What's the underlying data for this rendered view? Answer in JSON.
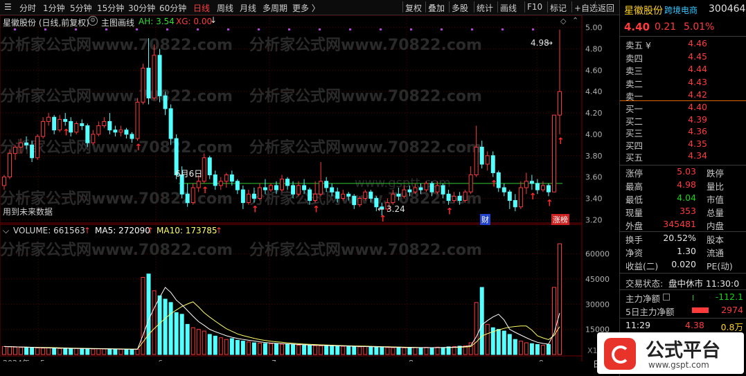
{
  "toolbar": {
    "left_items": [
      "分时",
      "1分钟",
      "5分钟",
      "15分钟",
      "30分钟",
      "60分钟",
      "日线",
      "周线",
      "月线",
      "多周期",
      "更多 〉"
    ],
    "active_item": "日线",
    "right_items": [
      "复权",
      "叠加",
      "多股",
      "统计",
      "画线",
      "F10",
      "标记",
      "+自选",
      "返回"
    ]
  },
  "chart_header": {
    "title": "星徽股份 (日线,前复权)",
    "indicator_name": "主图画线",
    "ah_text": "AH: 3.54",
    "xg_text": "XG: 0.00",
    "ah_color": "#33dd33",
    "xg_color": "#ff3a3a"
  },
  "watermarks": [
    "分析家公式网www.70822.com",
    "www.gsptt.com"
  ],
  "annotations": {
    "high_label": "4.98",
    "low_label": "3.24",
    "date_label": "6月6日",
    "future_data": "用到未来数据",
    "cai_badge": "财",
    "zhang_badge": "涨榜"
  },
  "volume_header": {
    "volume_text": "VOLUME: 661563",
    "ma5_text": "MA5: 272090",
    "ma10_text": "MA10: 173785",
    "x10_text": "X10"
  },
  "axes": {
    "price_ticks": [
      "5.00",
      "4.80",
      "4.60",
      "4.40",
      "4.20",
      "4.00",
      "3.80",
      "3.60",
      "3.40",
      "3.20"
    ],
    "volume_ticks": [
      "60000",
      "45000",
      "30000",
      "15000"
    ],
    "date_ticks": [
      "2024年",
      "5",
      "6",
      "7",
      "8",
      "9"
    ],
    "corner_label": "日"
  },
  "chart_data": {
    "type": "candlestick",
    "title": "星徽股份 (日线,前复权)",
    "ylim": [
      3.15,
      5.05
    ],
    "support_line": 3.54,
    "candles": [
      [
        3.52,
        3.6,
        3.48,
        3.62
      ],
      [
        3.6,
        3.82,
        3.58,
        3.86
      ],
      [
        3.82,
        3.88,
        3.76,
        3.9
      ],
      [
        3.88,
        3.92,
        3.82,
        3.96
      ],
      [
        3.92,
        3.9,
        3.86,
        3.98
      ],
      [
        3.9,
        3.78,
        3.74,
        3.94
      ],
      [
        3.78,
        3.98,
        3.76,
        4.0
      ],
      [
        3.98,
        4.12,
        3.96,
        4.16
      ],
      [
        4.12,
        4.16,
        4.08,
        4.2
      ],
      [
        4.16,
        4.04,
        4.0,
        4.18
      ],
      [
        4.04,
        4.14,
        4.02,
        4.18
      ],
      [
        4.14,
        4.12,
        4.08,
        4.2
      ],
      [
        4.12,
        4.02,
        3.98,
        4.16
      ],
      [
        4.02,
        4.1,
        4.0,
        4.12
      ],
      [
        4.1,
        4.08,
        4.04,
        4.14
      ],
      [
        4.08,
        3.92,
        3.88,
        4.1
      ],
      [
        3.92,
        4.0,
        3.9,
        4.04
      ],
      [
        4.0,
        4.08,
        3.98,
        4.12
      ],
      [
        4.08,
        4.12,
        4.06,
        4.16
      ],
      [
        4.12,
        4.04,
        4.0,
        4.2
      ],
      [
        4.04,
        4.02,
        3.98,
        4.08
      ],
      [
        4.02,
        4.04,
        3.98,
        4.08
      ],
      [
        4.04,
        4.0,
        3.96,
        4.06
      ],
      [
        4.0,
        3.96,
        3.92,
        4.02
      ],
      [
        3.96,
        4.3,
        3.94,
        4.34
      ],
      [
        4.3,
        4.62,
        4.28,
        4.66
      ],
      [
        4.62,
        4.34,
        4.28,
        4.9
      ],
      [
        4.34,
        4.74,
        4.32,
        4.84
      ],
      [
        4.74,
        4.36,
        4.3,
        4.8
      ],
      [
        4.36,
        4.24,
        4.18,
        4.4
      ],
      [
        4.24,
        3.96,
        3.9,
        4.28
      ],
      [
        3.96,
        3.62,
        3.58,
        4.0
      ],
      [
        3.62,
        3.44,
        3.4,
        3.7
      ],
      [
        3.44,
        3.36,
        3.32,
        3.54
      ],
      [
        3.36,
        3.5,
        3.34,
        3.54
      ],
      [
        3.5,
        3.56,
        3.46,
        3.62
      ],
      [
        3.56,
        3.78,
        3.54,
        3.82
      ],
      [
        3.78,
        3.62,
        3.58,
        3.8
      ],
      [
        3.62,
        3.52,
        3.48,
        3.66
      ],
      [
        3.52,
        3.56,
        3.48,
        3.6
      ],
      [
        3.56,
        3.62,
        3.5,
        3.64
      ],
      [
        3.62,
        3.56,
        3.52,
        3.66
      ],
      [
        3.56,
        3.48,
        3.44,
        3.58
      ],
      [
        3.48,
        3.36,
        3.3,
        3.52
      ],
      [
        3.36,
        3.44,
        3.34,
        3.48
      ],
      [
        3.44,
        3.4,
        3.36,
        3.5
      ],
      [
        3.4,
        3.5,
        3.38,
        3.54
      ],
      [
        3.5,
        3.48,
        3.44,
        3.58
      ],
      [
        3.48,
        3.52,
        3.46,
        3.54
      ],
      [
        3.52,
        3.48,
        3.44,
        3.56
      ],
      [
        3.48,
        3.58,
        3.46,
        3.62
      ],
      [
        3.58,
        3.52,
        3.48,
        3.6
      ],
      [
        3.52,
        3.44,
        3.4,
        3.56
      ],
      [
        3.44,
        3.52,
        3.42,
        3.56
      ],
      [
        3.52,
        3.48,
        3.44,
        3.58
      ],
      [
        3.48,
        3.38,
        3.34,
        3.5
      ],
      [
        3.38,
        3.44,
        3.36,
        3.56
      ],
      [
        3.44,
        3.56,
        3.42,
        3.74
      ],
      [
        3.56,
        3.5,
        3.46,
        3.6
      ],
      [
        3.5,
        3.46,
        3.42,
        3.54
      ],
      [
        3.46,
        3.4,
        3.36,
        3.5
      ],
      [
        3.4,
        3.44,
        3.38,
        3.48
      ],
      [
        3.44,
        3.42,
        3.38,
        3.46
      ],
      [
        3.42,
        3.34,
        3.3,
        3.44
      ],
      [
        3.34,
        3.4,
        3.32,
        3.42
      ],
      [
        3.4,
        3.46,
        3.38,
        3.48
      ],
      [
        3.46,
        3.4,
        3.36,
        3.48
      ],
      [
        3.4,
        3.32,
        3.28,
        3.42
      ],
      [
        3.32,
        3.3,
        3.24,
        3.36
      ],
      [
        3.3,
        3.36,
        3.28,
        3.4
      ],
      [
        3.36,
        3.44,
        3.34,
        3.48
      ],
      [
        3.44,
        3.42,
        3.38,
        3.5
      ],
      [
        3.42,
        3.48,
        3.4,
        3.52
      ],
      [
        3.48,
        3.46,
        3.42,
        3.52
      ],
      [
        3.46,
        3.5,
        3.44,
        3.54
      ],
      [
        3.5,
        3.48,
        3.44,
        3.54
      ],
      [
        3.48,
        3.54,
        3.46,
        3.56
      ],
      [
        3.54,
        3.46,
        3.42,
        3.56
      ],
      [
        3.46,
        3.52,
        3.44,
        3.56
      ],
      [
        3.52,
        3.44,
        3.4,
        3.54
      ],
      [
        3.44,
        3.38,
        3.34,
        3.48
      ],
      [
        3.38,
        3.42,
        3.36,
        3.46
      ],
      [
        3.42,
        3.38,
        3.34,
        3.46
      ],
      [
        3.38,
        3.46,
        3.36,
        3.48
      ],
      [
        3.46,
        3.62,
        3.44,
        3.7
      ],
      [
        3.62,
        3.88,
        3.6,
        4.08
      ],
      [
        3.88,
        3.72,
        3.68,
        3.94
      ],
      [
        3.72,
        3.8,
        3.66,
        3.84
      ],
      [
        3.8,
        3.64,
        3.6,
        3.84
      ],
      [
        3.64,
        3.5,
        3.46,
        3.66
      ],
      [
        3.5,
        3.46,
        3.42,
        3.54
      ],
      [
        3.46,
        3.38,
        3.3,
        3.48
      ],
      [
        3.38,
        3.32,
        3.28,
        3.44
      ],
      [
        3.32,
        3.5,
        3.3,
        3.56
      ],
      [
        3.5,
        3.56,
        3.44,
        3.64
      ],
      [
        3.56,
        3.54,
        3.48,
        3.62
      ],
      [
        3.54,
        3.48,
        3.44,
        3.58
      ],
      [
        3.48,
        3.52,
        3.46,
        3.56
      ],
      [
        3.52,
        3.46,
        3.42,
        3.54
      ],
      [
        3.46,
        4.18,
        3.46,
        4.18
      ],
      [
        4.18,
        4.4,
        4.0,
        4.98
      ]
    ],
    "volume": [
      4800,
      4600,
      4400,
      4200,
      4100,
      4000,
      3900,
      3800,
      3900,
      3700,
      3600,
      3700,
      3500,
      3600,
      3400,
      3500,
      3300,
      3400,
      3300,
      3200,
      3300,
      3100,
      3000,
      3100,
      3200,
      46000,
      48000,
      38000,
      35000,
      33000,
      31000,
      25000,
      24000,
      18000,
      16000,
      15000,
      14000,
      12000,
      11000,
      10000,
      9000,
      9500,
      8500,
      8000,
      7500,
      7000,
      6800,
      6600,
      6500,
      6400,
      6200,
      6000,
      5800,
      5600,
      5500,
      5400,
      5300,
      5200,
      5400,
      5100,
      5000,
      4900,
      4800,
      4700,
      4600,
      4800,
      4500,
      4400,
      4300,
      4200,
      4100,
      4300,
      4000,
      3900,
      4200,
      4100,
      4300,
      4000,
      4400,
      4200,
      4600,
      4800,
      5000,
      5200,
      7000,
      31000,
      40000,
      18000,
      16000,
      15000,
      14000,
      12000,
      9000,
      8000,
      7000,
      6500,
      6000,
      5500,
      6000,
      40000,
      66000
    ],
    "volume_ylim": [
      0,
      66000
    ],
    "volume_max_label": 66156.3
  },
  "quote": {
    "name": "星徽股份",
    "sector": "跨境电商",
    "code": "300464",
    "price": "4.40",
    "change": "0.21",
    "change_pct": "5.01%",
    "asks": [
      {
        "label": "卖五",
        "extra": "¥",
        "price": "4.46"
      },
      {
        "label": "卖四",
        "extra": "",
        "price": "4.45"
      },
      {
        "label": "卖三",
        "extra": "",
        "price": "4.44"
      },
      {
        "label": "卖二",
        "extra": "",
        "price": "4.43"
      },
      {
        "label": "卖一",
        "extra": "",
        "price": "4.42"
      }
    ],
    "bids": [
      {
        "label": "买一",
        "price": "4.40"
      },
      {
        "label": "买二",
        "price": "4.39"
      },
      {
        "label": "买三",
        "price": "4.36"
      },
      {
        "label": "买四",
        "price": "4.35"
      },
      {
        "label": "买五",
        "price": "4.34"
      }
    ],
    "stats": [
      {
        "l1": "涨停",
        "v1": "5.03",
        "c1": "red",
        "l2": "跌停"
      },
      {
        "l1": "最高",
        "v1": "4.98",
        "c1": "red",
        "l2": "量比"
      },
      {
        "l1": "最低",
        "v1": "4.04",
        "c1": "green",
        "l2": "市值"
      },
      {
        "l1": "现量",
        "v1": "353",
        "c1": "red",
        "l2": "总量"
      },
      {
        "l1": "外盘",
        "v1": "345481",
        "c1": "red",
        "l2": "内盘"
      }
    ],
    "stats2": [
      {
        "l1": "换手",
        "v1": "20.52%",
        "l2": "股本"
      },
      {
        "l1": "净资",
        "v1": "1.30",
        "l2": "流通"
      },
      {
        "l1": "收益(二)",
        "v1": "0.020",
        "l2": "PE(动)"
      }
    ],
    "trade_status_label": "交易状态:",
    "trade_status_value": "盘中休市 11:30:0",
    "main_net_label": "主力净额",
    "main_net_value": "-112.1",
    "main_net5_label": "5日主力净额",
    "main_net5_value": "2974",
    "tick_time": "11:29",
    "tick_price": "4.38",
    "tick_vol": "0.8万"
  },
  "brand": {
    "name": "公式平台",
    "url": "www.gspt.com"
  },
  "colors": {
    "up": "#ff3b3b",
    "down": "#54ffff",
    "ma5": "#ffffff",
    "ma10": "#ffff66",
    "support": "#33cc33",
    "grid": "#5a0000"
  }
}
